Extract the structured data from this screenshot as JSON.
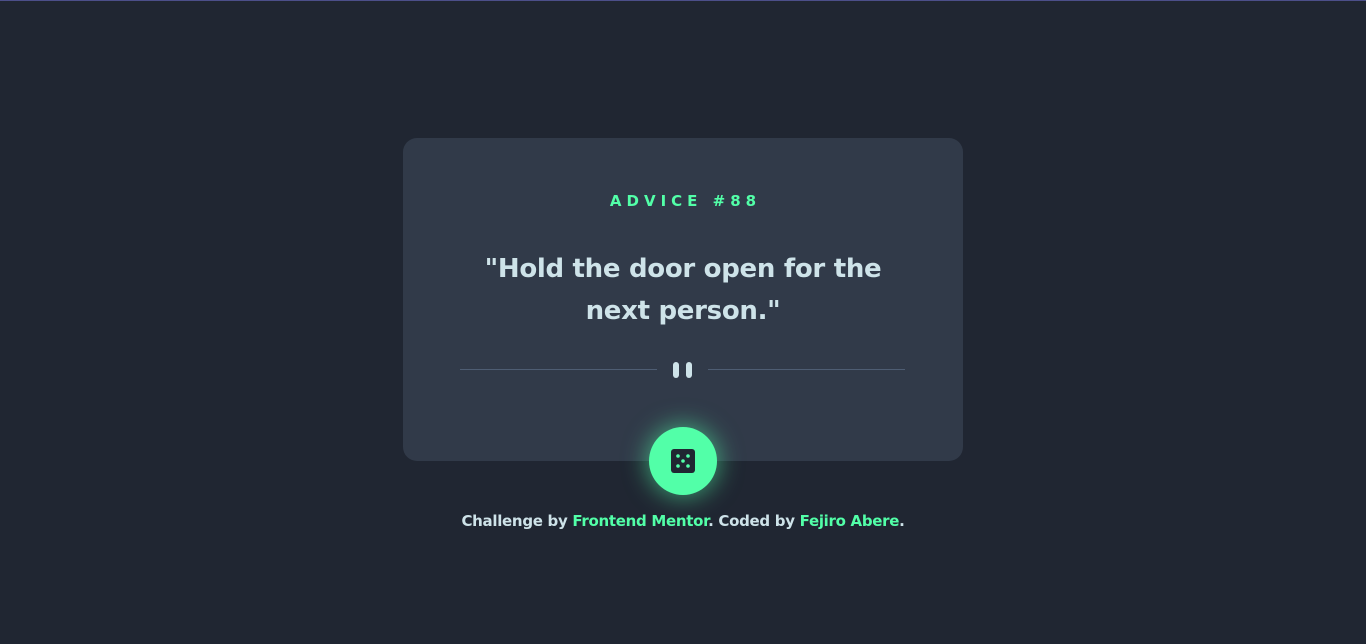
{
  "advice": {
    "label": "ADVICE #88",
    "quote": "\"Hold the door open for the next person.\""
  },
  "divider": {
    "icon": "pause-icon"
  },
  "dice_button": {
    "icon": "dice-icon"
  },
  "attribution": {
    "prefix": "Challenge by ",
    "link1": "Frontend Mentor",
    "middle": ". Coded by ",
    "link2": "Fejiro Abere",
    "suffix": "."
  },
  "colors": {
    "background": "#202632",
    "card": "#313a49",
    "accent": "#52ffa8",
    "text": "#cee3e9",
    "divider": "#4e5d73"
  }
}
